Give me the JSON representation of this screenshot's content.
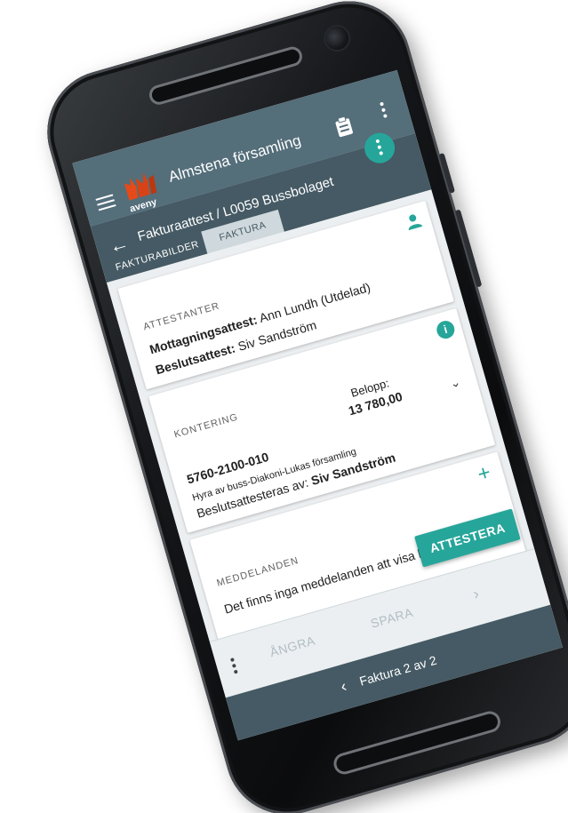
{
  "app": {
    "logo_text": "aveny",
    "title": "Almstena församling"
  },
  "header": {
    "breadcrumb": "Fakturaattest / L0059 Bussbolaget"
  },
  "tabs": [
    {
      "label": "FAKTURABILDER",
      "active": false
    },
    {
      "label": "FAKTURA",
      "active": true
    }
  ],
  "attestanter": {
    "label": "ATTESTANTER",
    "rows": [
      {
        "key": "Mottagningsattest:",
        "value": "Ann Lundh (Utdelad)"
      },
      {
        "key": "Beslutsattest:",
        "value": "Siv Sandström"
      }
    ]
  },
  "kontering": {
    "label": "KONTERING",
    "account": "5760-2100-010",
    "amount_label": "Belopp:",
    "amount": "13 780,00",
    "description": "Hyra av buss-Diakoni-Lukas församling",
    "beslut_prefix": "Beslutsattesteras av:",
    "beslut_name": "Siv Sandström"
  },
  "meddelanden": {
    "label": "MEDDELANDEN",
    "empty_text": "Det finns inga meddelanden att visa här"
  },
  "actions": {
    "attestera": "ATTESTERA",
    "angra": "ÅNGRA",
    "spara": "SPARA"
  },
  "pager": {
    "label": "Faktura 2 av 2"
  },
  "colors": {
    "appbar": "#546e7a",
    "toolbar": "#455a64",
    "accent": "#26a69a"
  }
}
